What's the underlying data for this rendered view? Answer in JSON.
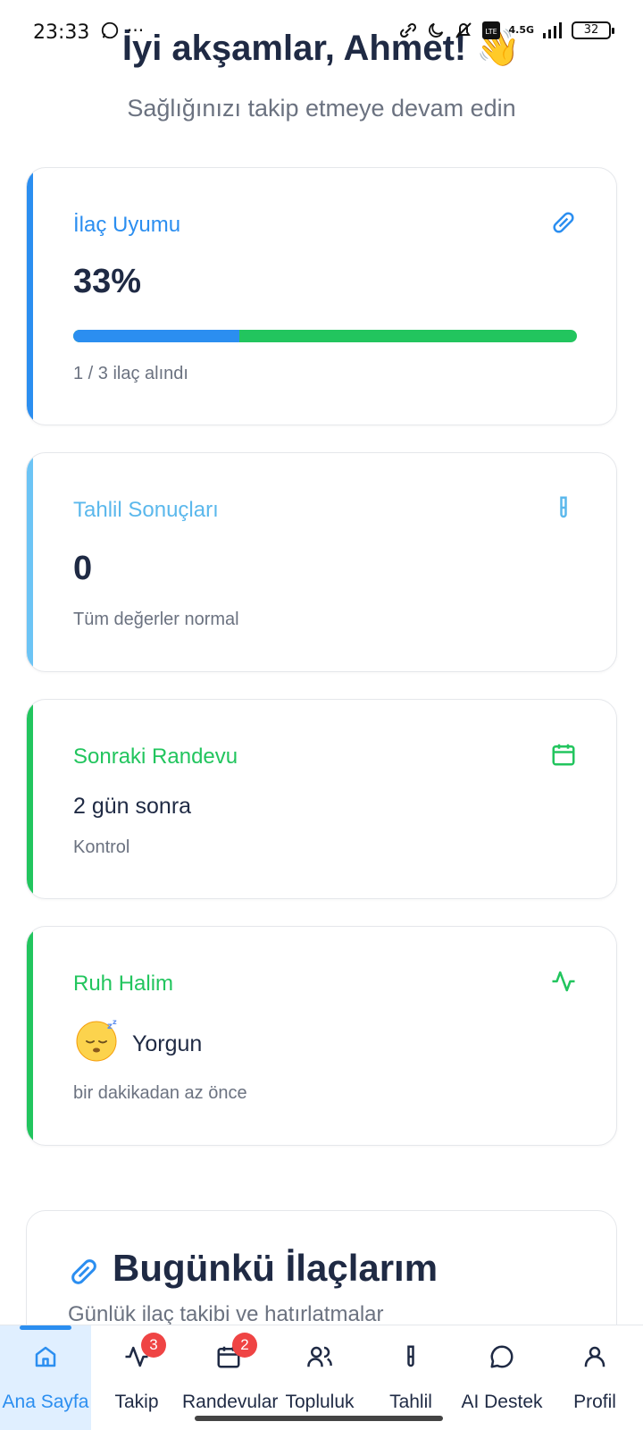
{
  "status_bar": {
    "time": "23:33",
    "network": "4.5G",
    "battery": "32"
  },
  "header": {
    "greeting": "İyi akşamlar, Ahmet! 👋",
    "subtitle": "Sağlığınızı takip etmeye devam edin"
  },
  "cards": {
    "medication": {
      "title": "İlaç Uyumu",
      "value": "33%",
      "progress": 0.33,
      "subtitle": "1 / 3 ilaç alındı",
      "color": "#2b8ef0"
    },
    "lab": {
      "title": "Tahlil Sonuçları",
      "value": "0",
      "subtitle": "Tüm değerler normal",
      "color": "#6cc4f5"
    },
    "appointment": {
      "title": "Sonraki Randevu",
      "value": "2 gün sonra",
      "subtitle": "Kontrol",
      "color": "#22c55e"
    },
    "mood": {
      "title": "Ruh Halim",
      "value": "Yorgun",
      "subtitle": "bir dakikadan az önce",
      "emoji": "sleeping-face-icon",
      "color": "#22c55e"
    }
  },
  "section": {
    "title": "Bugünkü İlaçlarım",
    "subtitle": "Günlük ilaç takibi ve hatırlatmalar"
  },
  "nav": {
    "items": [
      {
        "label": "Ana Sayfa",
        "icon": "home-icon",
        "active": true
      },
      {
        "label": "Takip",
        "icon": "activity-icon",
        "badge": "3"
      },
      {
        "label": "Randevular",
        "icon": "calendar-icon",
        "badge": "2"
      },
      {
        "label": "Topluluk",
        "icon": "users-icon"
      },
      {
        "label": "Tahlil",
        "icon": "test-tube-icon"
      },
      {
        "label": "AI Destek",
        "icon": "chat-icon"
      },
      {
        "label": "Profil",
        "icon": "user-icon"
      }
    ]
  }
}
